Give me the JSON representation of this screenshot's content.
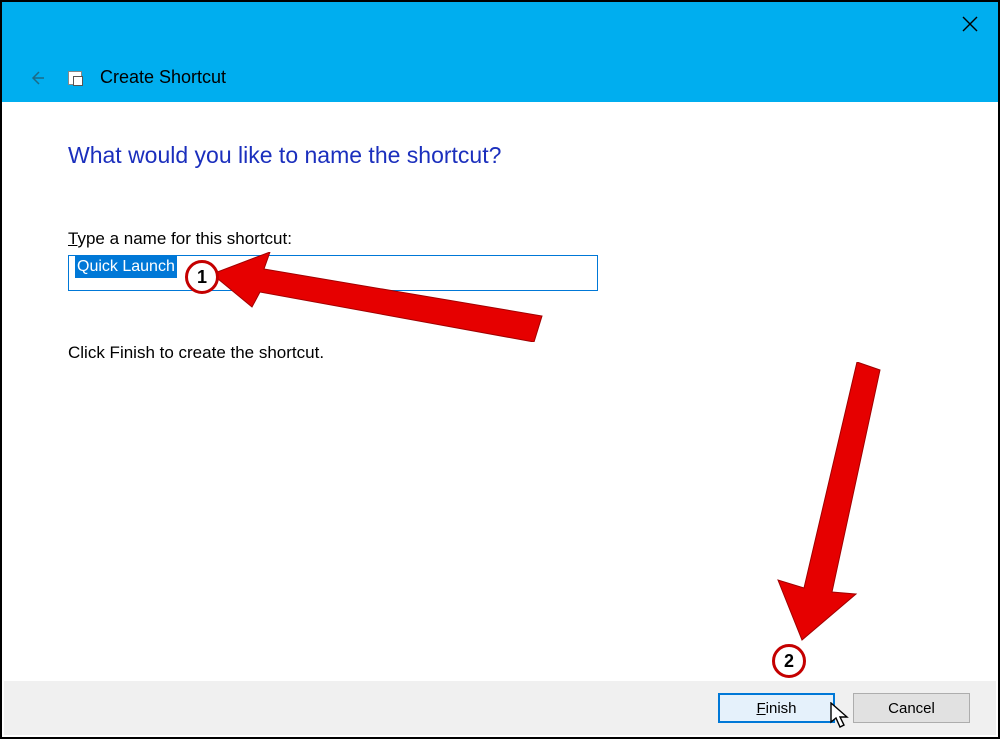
{
  "titlebar": {
    "window_title": "Create Shortcut"
  },
  "content": {
    "heading": "What would you like to name the shortcut?",
    "field_label_prefix": "T",
    "field_label_rest": "ype a name for this shortcut:",
    "input_value": "Quick Launch",
    "hint": "Click Finish to create the shortcut."
  },
  "footer": {
    "finish_prefix": "F",
    "finish_rest": "inish",
    "cancel_label": "Cancel"
  },
  "annotations": {
    "badge1": "1",
    "badge2": "2"
  }
}
